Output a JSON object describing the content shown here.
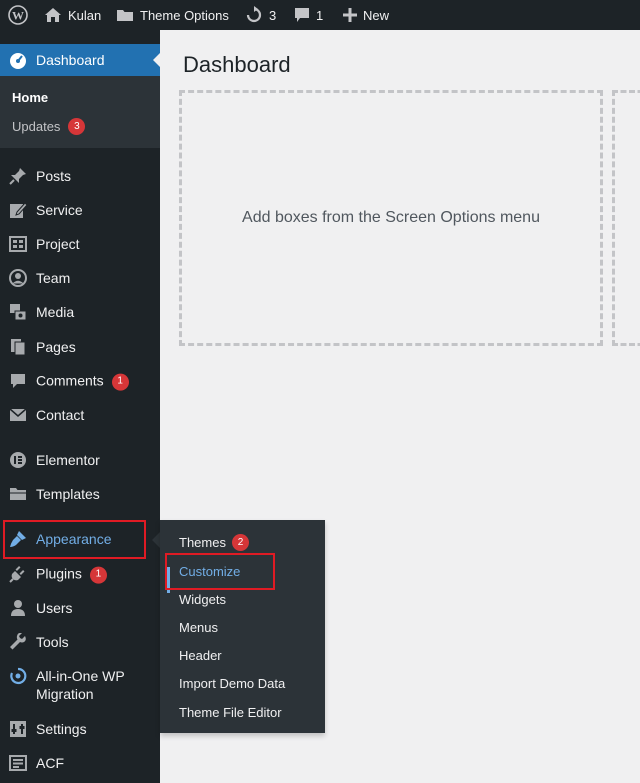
{
  "admin_bar": {
    "site_name": "Kulan",
    "theme_options": "Theme Options",
    "updates_count": "3",
    "comments_count": "1",
    "new_label": "New"
  },
  "sidebar": {
    "dashboard": "Dashboard",
    "home": "Home",
    "updates": "Updates",
    "updates_badge": "3",
    "items": [
      {
        "label": "Posts",
        "icon": "pin-icon"
      },
      {
        "label": "Service",
        "icon": "edit-icon"
      },
      {
        "label": "Project",
        "icon": "grid-icon"
      },
      {
        "label": "Team",
        "icon": "person-circle-icon"
      },
      {
        "label": "Media",
        "icon": "media-icon"
      },
      {
        "label": "Pages",
        "icon": "pages-icon"
      },
      {
        "label": "Comments",
        "icon": "comment-icon",
        "badge": "1"
      },
      {
        "label": "Contact",
        "icon": "mail-icon"
      },
      {
        "label": "Elementor",
        "icon": "elementor-icon"
      },
      {
        "label": "Templates",
        "icon": "folder-icon"
      },
      {
        "label": "Appearance",
        "icon": "brush-icon"
      },
      {
        "label": "Plugins",
        "icon": "plug-icon",
        "badge": "1"
      },
      {
        "label": "Users",
        "icon": "user-icon"
      },
      {
        "label": "Tools",
        "icon": "wrench-icon"
      },
      {
        "label": "All-in-One WP Migration",
        "icon": "migration-icon"
      },
      {
        "label": "Settings",
        "icon": "settings-icon"
      },
      {
        "label": "ACF",
        "icon": "acf-icon"
      }
    ]
  },
  "flyout": {
    "items": [
      "Themes",
      "Customize",
      "Widgets",
      "Menus",
      "Header",
      "Import Demo Data",
      "Theme File Editor"
    ],
    "themes_badge": "2"
  },
  "main": {
    "title": "Dashboard",
    "empty_message": "Add boxes from the Screen Options menu"
  },
  "colors": {
    "admin_bg": "#1d2327",
    "accent": "#2271b1",
    "highlight": "#72aee6",
    "badge": "#d63638",
    "annotation": "#e01b24"
  }
}
